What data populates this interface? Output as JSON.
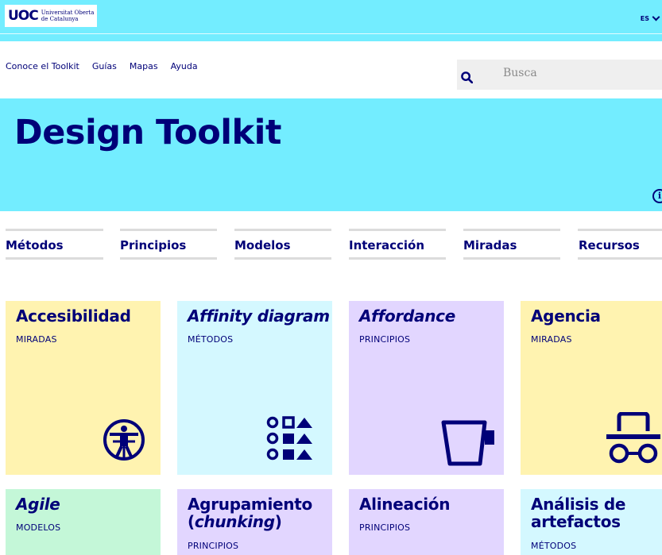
{
  "header": {
    "logo_mark": "UOC",
    "logo_line1": "Universitat Oberta",
    "logo_line2": "de Catalunya",
    "language": "ES",
    "colors": {
      "brand_cyan": "#73edff",
      "navy": "#000078"
    }
  },
  "nav": {
    "items": [
      "Conoce el Toolkit",
      "Guías",
      "Mapas",
      "Ayuda"
    ],
    "search_placeholder": "Busca"
  },
  "hero": {
    "title": "Design Toolkit",
    "info_icon": "info-icon"
  },
  "categories": [
    "Métodos",
    "Principios",
    "Modelos",
    "Interacción",
    "Miradas",
    "Recursos"
  ],
  "cards": [
    {
      "title": "Accesibilidad",
      "subtitle": "MIRADAS",
      "color": "#fff3b0",
      "icon": "vitruvian-accessibility-icon"
    },
    {
      "title": "Affinity diagram",
      "subtitle": "MÉTODOS",
      "color": "#d4f8ff",
      "icon": "shapes-grid-icon"
    },
    {
      "title": "Affordance",
      "subtitle": "PRINCIPIOS",
      "color": "#e2d6ff",
      "icon": "cup-icon"
    },
    {
      "title": "Agencia",
      "subtitle": "MIRADAS",
      "color": "#fff3b0",
      "icon": "hat-glasses-icon"
    },
    {
      "title": "Agile",
      "subtitle": "MODELOS",
      "color": "#c4f7d8"
    },
    {
      "title_line1": "Agrupamiento",
      "title_line2_open": "(",
      "title_line2_italic": "chunking",
      "title_line2_close": ")",
      "subtitle": "PRINCIPIOS",
      "color": "#e2d6ff"
    },
    {
      "title": "Alineación",
      "subtitle": "PRINCIPIOS",
      "color": "#e2d6ff"
    },
    {
      "title_line1": "Análisis de",
      "title_line2": "artefactos",
      "subtitle": "MÉTODOS",
      "color": "#d4f8ff"
    }
  ]
}
